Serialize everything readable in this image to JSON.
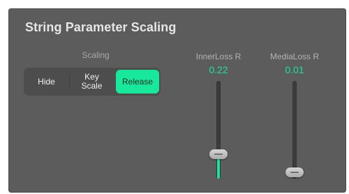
{
  "title": "String Parameter Scaling",
  "scaling": {
    "label": "Scaling",
    "options": [
      "Hide",
      "Key\nScale",
      "Release"
    ],
    "selected": "Release"
  },
  "sliders": [
    {
      "name": "InnerLoss R",
      "value_text": "0.22",
      "level": 0.22
    },
    {
      "name": "MediaLoss R",
      "value_text": "0.01",
      "level": 0.01
    }
  ],
  "colors": {
    "panel_bg": "#5c5c5c",
    "accent": "#18e89c",
    "segmented_bg": "#4d4d4d"
  }
}
